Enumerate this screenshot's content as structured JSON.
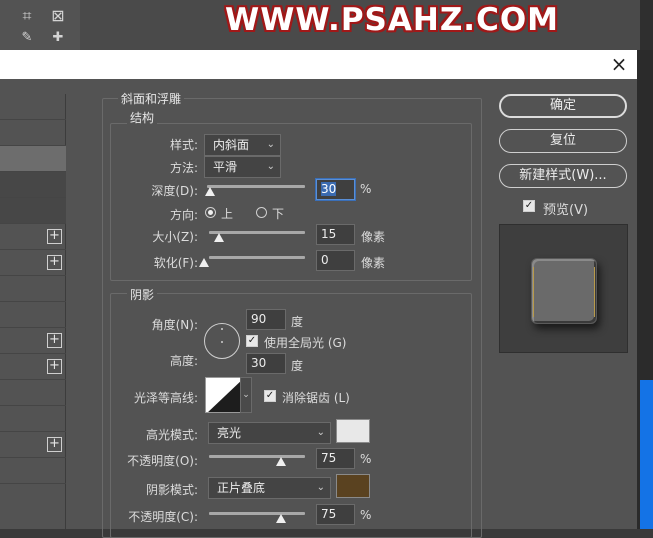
{
  "background": {
    "watermark": "WWW.PSAHZ.COM",
    "tool_icons": [
      "crop-icon",
      "frame-icon",
      "eyedropper-icon",
      "healing-brush-icon"
    ]
  },
  "dialog": {
    "close_glyph": "×"
  },
  "bevel": {
    "group_title": "斜面和浮雕",
    "structure_title": "结构",
    "style_label": "样式:",
    "style_value": "内斜面",
    "technique_label": "方法:",
    "technique_value": "平滑",
    "depth_label": "深度(D):",
    "depth_value": "30",
    "depth_unit": "%",
    "direction_label": "方向:",
    "direction_up": "上",
    "direction_down": "下",
    "direction_selected": "up",
    "size_label": "大小(Z):",
    "size_value": "15",
    "size_unit": "像素",
    "soften_label": "软化(F):",
    "soften_value": "0",
    "soften_unit": "像素",
    "depth_slider_fraction": 0.03,
    "size_slider_fraction": 0.1,
    "soften_slider_fraction": 0.0
  },
  "shading": {
    "group_title": "阴影",
    "angle_label": "角度(N):",
    "angle_value": "90",
    "angle_unit": "度",
    "global_light_label": "使用全局光 (G)",
    "global_light_checked": true,
    "altitude_label": "高度:",
    "altitude_value": "30",
    "altitude_unit": "度",
    "gloss_contour_label": "光泽等高线:",
    "anti_alias_label": "消除锯齿 (L)",
    "anti_alias_checked": true,
    "highlight_mode_label": "高光模式:",
    "highlight_mode_value": "亮光",
    "highlight_color": "#e8e8e8",
    "highlight_opacity_label": "不透明度(O):",
    "highlight_opacity_value": "75",
    "highlight_opacity_unit": "%",
    "shadow_mode_label": "阴影模式:",
    "shadow_mode_value": "正片叠底",
    "shadow_color": "#5a4220",
    "shadow_opacity_label": "不透明度(C):",
    "shadow_opacity_value": "75",
    "shadow_opacity_unit": "%",
    "highlight_slider_fraction": 0.75,
    "shadow_slider_fraction": 0.75
  },
  "buttons": {
    "ok": "确定",
    "reset": "复位",
    "new_style": "新建样式(W)...",
    "preview_label": "预览(V)",
    "preview_checked": true
  },
  "colors": {
    "accent_blue": "#1473e6",
    "watermark_outline": "#a01818"
  }
}
